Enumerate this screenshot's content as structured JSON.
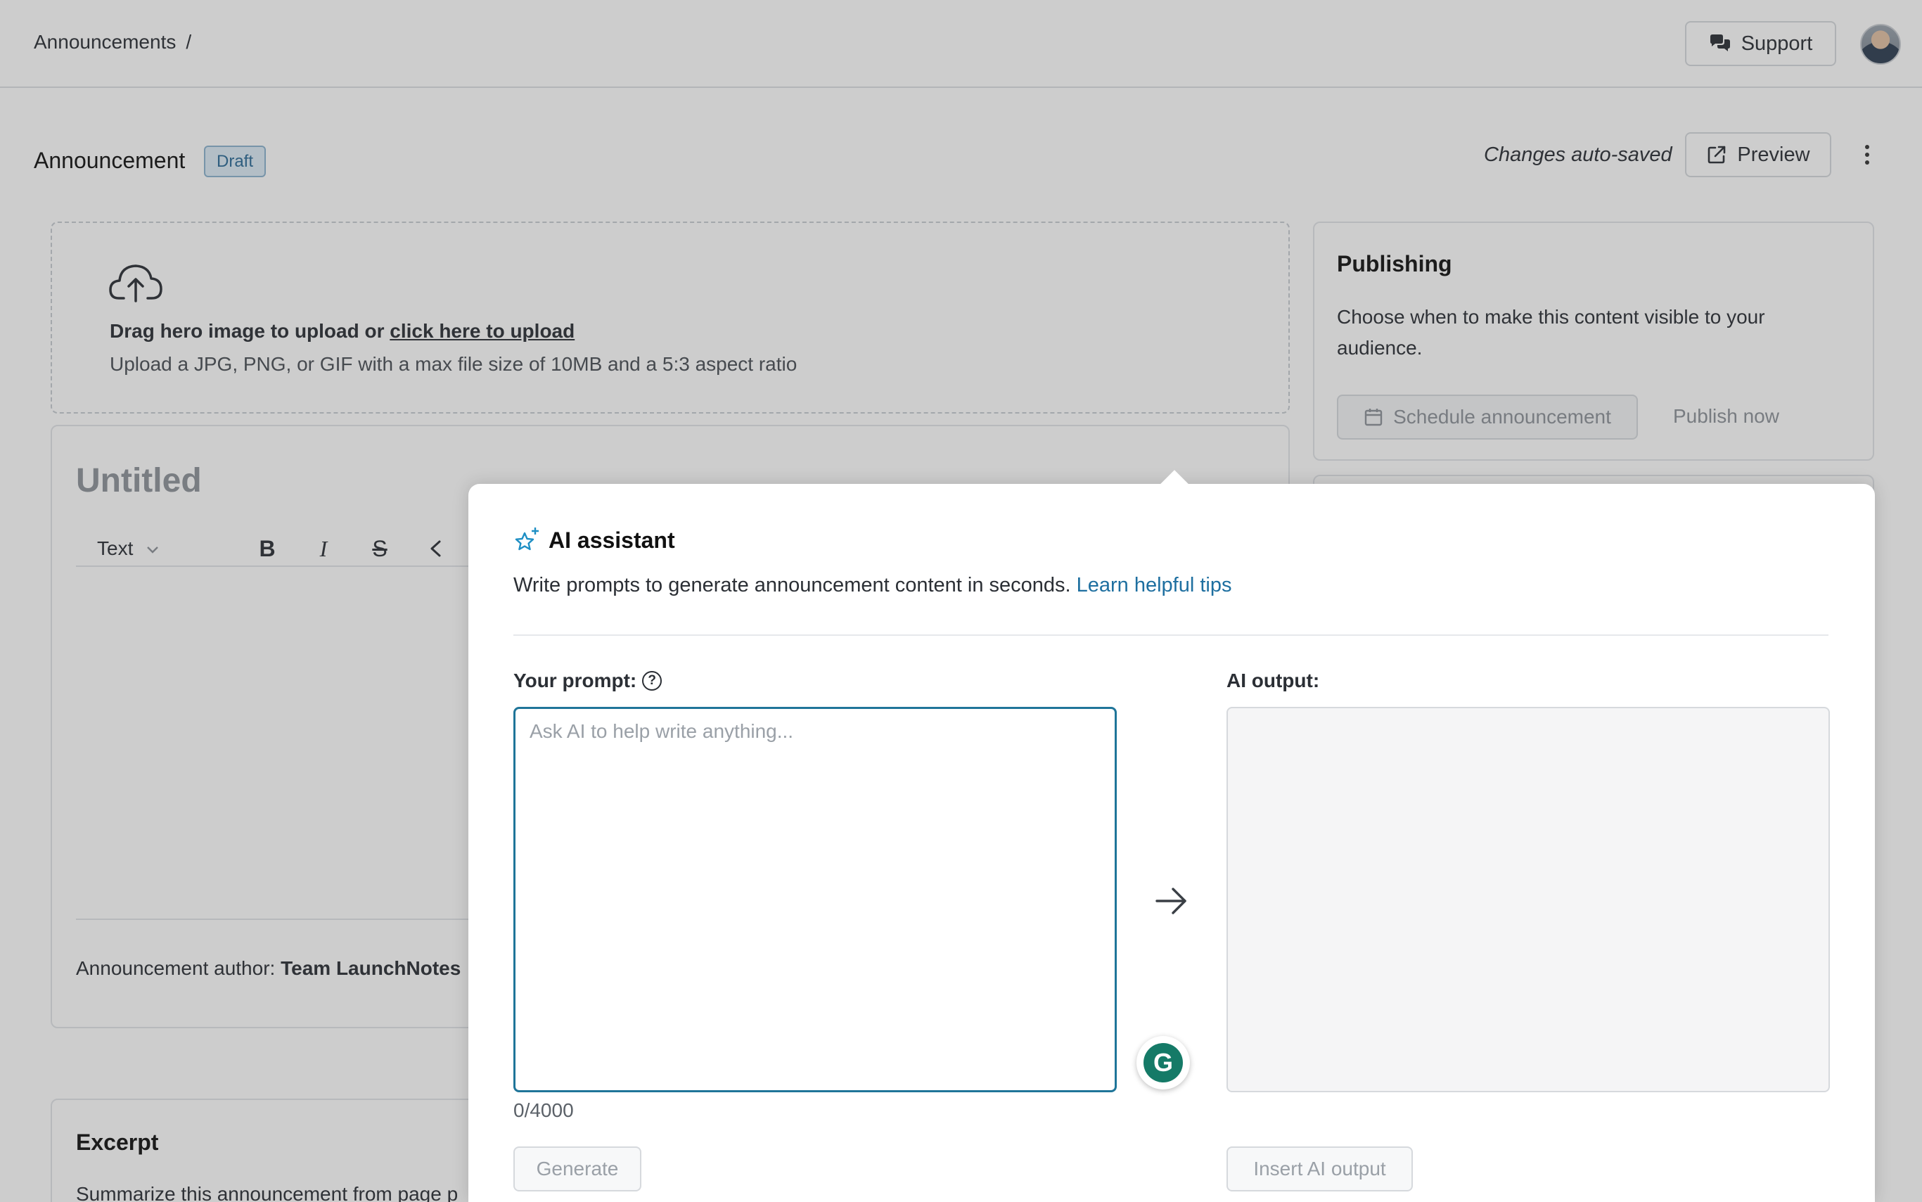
{
  "header": {
    "breadcrumb": "Announcements",
    "breadcrumb_separator": "/",
    "support_label": "Support"
  },
  "title_bar": {
    "title": "Announcement",
    "status_badge": "Draft",
    "autosave_text": "Changes auto-saved",
    "preview_label": "Preview"
  },
  "upload": {
    "drag_text": "Drag hero image to upload or ",
    "link_text": "click here to upload",
    "hint": "Upload a JPG, PNG, or GIF with a max file size of 10MB and a 5:3 aspect ratio"
  },
  "editor": {
    "title_placeholder": "Untitled",
    "format_select": "Text",
    "author_label": "Announcement author: ",
    "author_name": "Team LaunchNotes"
  },
  "excerpt": {
    "title": "Excerpt",
    "description": "Summarize this announcement from page p"
  },
  "publishing": {
    "title": "Publishing",
    "description": "Choose when to make this content visible to your audience.",
    "schedule_label": "Schedule announcement",
    "publish_now_label": "Publish now"
  },
  "ai_modal": {
    "title": "AI assistant",
    "description": "Write prompts to generate announcement content in seconds.",
    "tips_link": "Learn helpful tips",
    "prompt_label": "Your prompt:",
    "prompt_placeholder": "Ask AI to help write anything...",
    "prompt_value": "",
    "counter": "0/4000",
    "output_label": "AI output:",
    "generate_label": "Generate",
    "insert_label": "Insert AI output"
  },
  "icons": {
    "support": "chat-bubbles-icon",
    "preview": "external-link-icon",
    "upload": "cloud-upload-icon",
    "calendar": "calendar-icon",
    "ai": "sparkle-star-icon",
    "arrow": "arrow-right-icon",
    "grammarly": "grammarly-icon"
  },
  "colors": {
    "accent": "#1f7599",
    "link": "#1e6fa0",
    "badge_bg": "#dcebf6",
    "grammarly": "#157a67"
  }
}
